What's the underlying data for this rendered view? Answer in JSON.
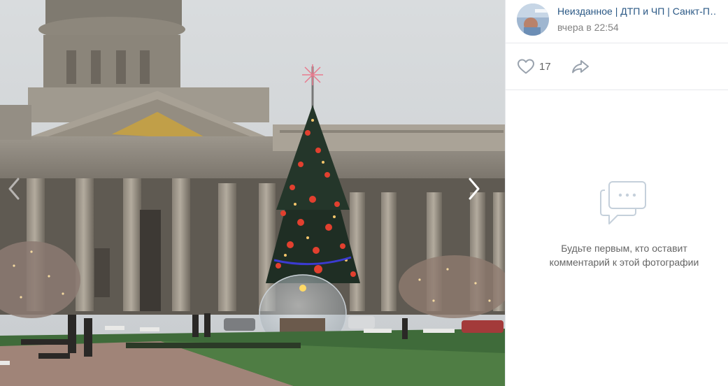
{
  "post": {
    "author": "Неизданное | ДТП и ЧП | Санкт-Петербург",
    "time": "вчера в 22:54"
  },
  "actions": {
    "likes": "17"
  },
  "comments": {
    "empty_line1": "Будьте первым, кто оставит",
    "empty_line2": "комментарий к этой фотографии"
  },
  "colors": {
    "link": "#2a5885",
    "muted": "#828282",
    "icon": "#99a2ad",
    "divider": "#e7e8ec"
  },
  "icons": {
    "prev": "chevron-left-icon",
    "next": "chevron-right-icon",
    "like": "heart-icon",
    "share": "share-arrow-icon",
    "comments": "speech-bubble-icon"
  }
}
